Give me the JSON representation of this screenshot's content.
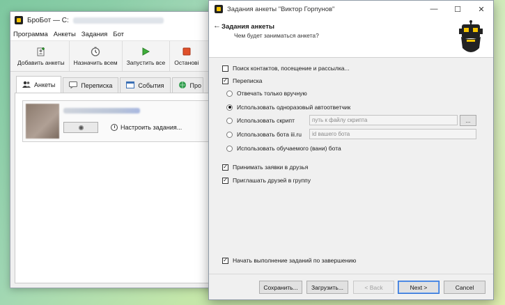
{
  "back_window": {
    "title": "БроБот — C:",
    "menu": [
      "Программа",
      "Анкеты",
      "Задания",
      "Бот"
    ],
    "toolbar": {
      "add_profiles": "Добавить анкеты",
      "assign_all": "Назначить всем",
      "run_all": "Запустить все",
      "stop_cut": "Останові"
    },
    "tabs": {
      "profiles": "Анкеты",
      "messages": "Переписка",
      "events": "События",
      "cut": "Про"
    },
    "profile_card": {
      "configure_tasks": "Настроить задания...",
      "cut_text": "Б"
    }
  },
  "dialog": {
    "title": "Задания анкеты \"Виктор Горпунов\"",
    "controls": {
      "minimize": "—",
      "maximize": "☐",
      "close": "✕"
    },
    "header": {
      "back": "←",
      "title": "Задания анкеты",
      "subtitle": "Чем будет заниматься анкета?"
    },
    "options": {
      "search_contacts": {
        "label": "Поиск контактов, посещение и рассылка...",
        "checked": false
      },
      "messaging": {
        "label": "Переписка",
        "checked": true
      },
      "radio_manual": {
        "label": "Отвечать только вручную",
        "checked": false
      },
      "radio_autoresponder": {
        "label": "Использовать одноразовый автоответчик",
        "checked": true
      },
      "radio_script": {
        "label": "Использовать скрипт",
        "checked": false,
        "placeholder": "путь к файлу скрипта",
        "browse": "..."
      },
      "radio_iii_bot": {
        "label": "Использовать бота iii.ru",
        "checked": false,
        "placeholder": "id вашего бота"
      },
      "radio_trained_bot": {
        "label": "Использовать обучаемого (вани) бота",
        "checked": false
      },
      "accept_friends": {
        "label": "Принимать заявки в друзья",
        "checked": true
      },
      "invite_group": {
        "label": "Приглашать друзей в группу",
        "checked": true
      },
      "start_on_finish": {
        "label": "Начать выполнение заданий по завершению",
        "checked": true
      }
    },
    "buttons": {
      "save": "Сохранить...",
      "load": "Загрузить...",
      "back": "< Back",
      "next": "Next >",
      "cancel": "Cancel"
    }
  }
}
